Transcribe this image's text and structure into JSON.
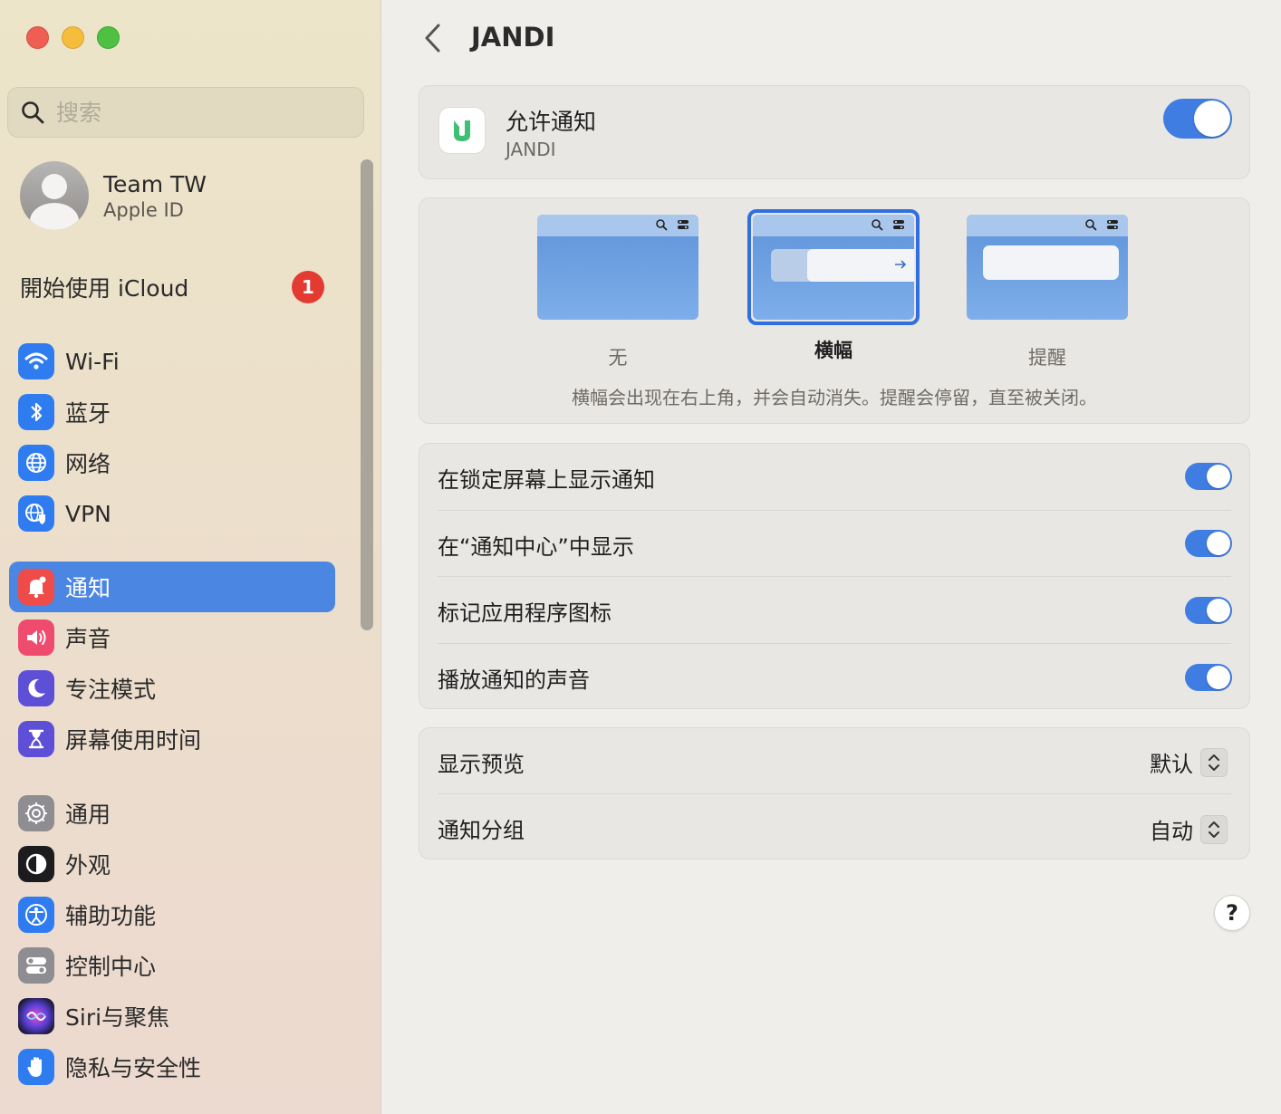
{
  "colors": {
    "accent": "#4c86e3",
    "toggle_on": "#3f7de2",
    "badge": "#e33b31"
  },
  "search": {
    "placeholder": "搜索",
    "icon": "search-icon"
  },
  "profile": {
    "name": "Team TW",
    "subtitle": "Apple ID"
  },
  "icloud": {
    "label": "開始使用 iCloud",
    "badge": "1"
  },
  "sidebar": {
    "items": [
      {
        "label": "Wi-Fi",
        "icon": "wifi-icon"
      },
      {
        "label": "蓝牙",
        "icon": "bluetooth-icon"
      },
      {
        "label": "网络",
        "icon": "network-icon"
      },
      {
        "label": "VPN",
        "icon": "vpn-icon"
      },
      {
        "label": "通知",
        "icon": "bell-icon",
        "active": true
      },
      {
        "label": "声音",
        "icon": "speaker-icon"
      },
      {
        "label": "专注模式",
        "icon": "moon-icon"
      },
      {
        "label": "屏幕使用时间",
        "icon": "hourglass-icon"
      },
      {
        "label": "通用",
        "icon": "gear-icon"
      },
      {
        "label": "外观",
        "icon": "appearance-icon"
      },
      {
        "label": "辅助功能",
        "icon": "accessibility-icon"
      },
      {
        "label": "控制中心",
        "icon": "control-center-icon"
      },
      {
        "label": "Siri与聚焦",
        "icon": "siri-icon"
      },
      {
        "label": "隐私与安全性",
        "icon": "hand-icon"
      }
    ]
  },
  "header": {
    "title": "JANDI",
    "back_icon": "chevron-left-icon"
  },
  "allow": {
    "title": "允许通知",
    "app_name": "JANDI",
    "enabled": true
  },
  "alert_style": {
    "options": [
      {
        "label": "无",
        "selected": false
      },
      {
        "label": "横幅",
        "selected": true
      },
      {
        "label": "提醒",
        "selected": false
      }
    ],
    "description": "横幅会出现在右上角，并会自动消失。提醒会停留，直至被关闭。"
  },
  "toggles": [
    {
      "label": "在锁定屏幕上显示通知",
      "enabled": true
    },
    {
      "label": "在“通知中心”中显示",
      "enabled": true
    },
    {
      "label": "标记应用程序图标",
      "enabled": true
    },
    {
      "label": "播放通知的声音",
      "enabled": true
    }
  ],
  "selects": [
    {
      "label": "显示预览",
      "value": "默认"
    },
    {
      "label": "通知分组",
      "value": "自动"
    }
  ],
  "help": {
    "label": "?"
  }
}
